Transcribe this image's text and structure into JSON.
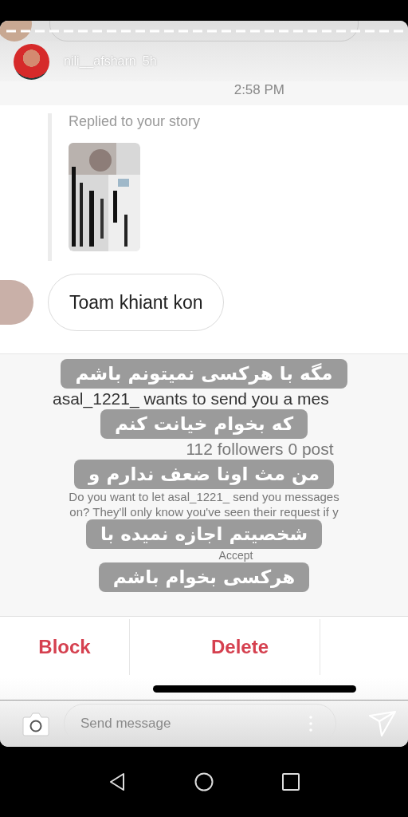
{
  "story": {
    "username": "nili__afsharn",
    "age": "5h"
  },
  "chat": {
    "time": "2:58 PM",
    "reply_label": "Replied to your story",
    "message": "Toam khiant kon"
  },
  "request": {
    "title": "asal_1221_ wants to send you a mes",
    "stats": "112 followers 0 post",
    "question_lines": [
      "Do you want to let asal_1221_ send you messages",
      "on? They'll only know you've seen their request if y"
    ],
    "accept": "Accept"
  },
  "actions": [
    "Block",
    "Delete"
  ],
  "caption_lines": [
    "مگه با هرکسی نمیتونم باشم",
    "که بخوام خیانت کنم",
    "من مث اونا ضعف ندارم و",
    "شخصیتم اجازه نمیده با",
    "هرکسی بخوام باشم"
  ],
  "reply_bar": {
    "placeholder": "Send message"
  }
}
